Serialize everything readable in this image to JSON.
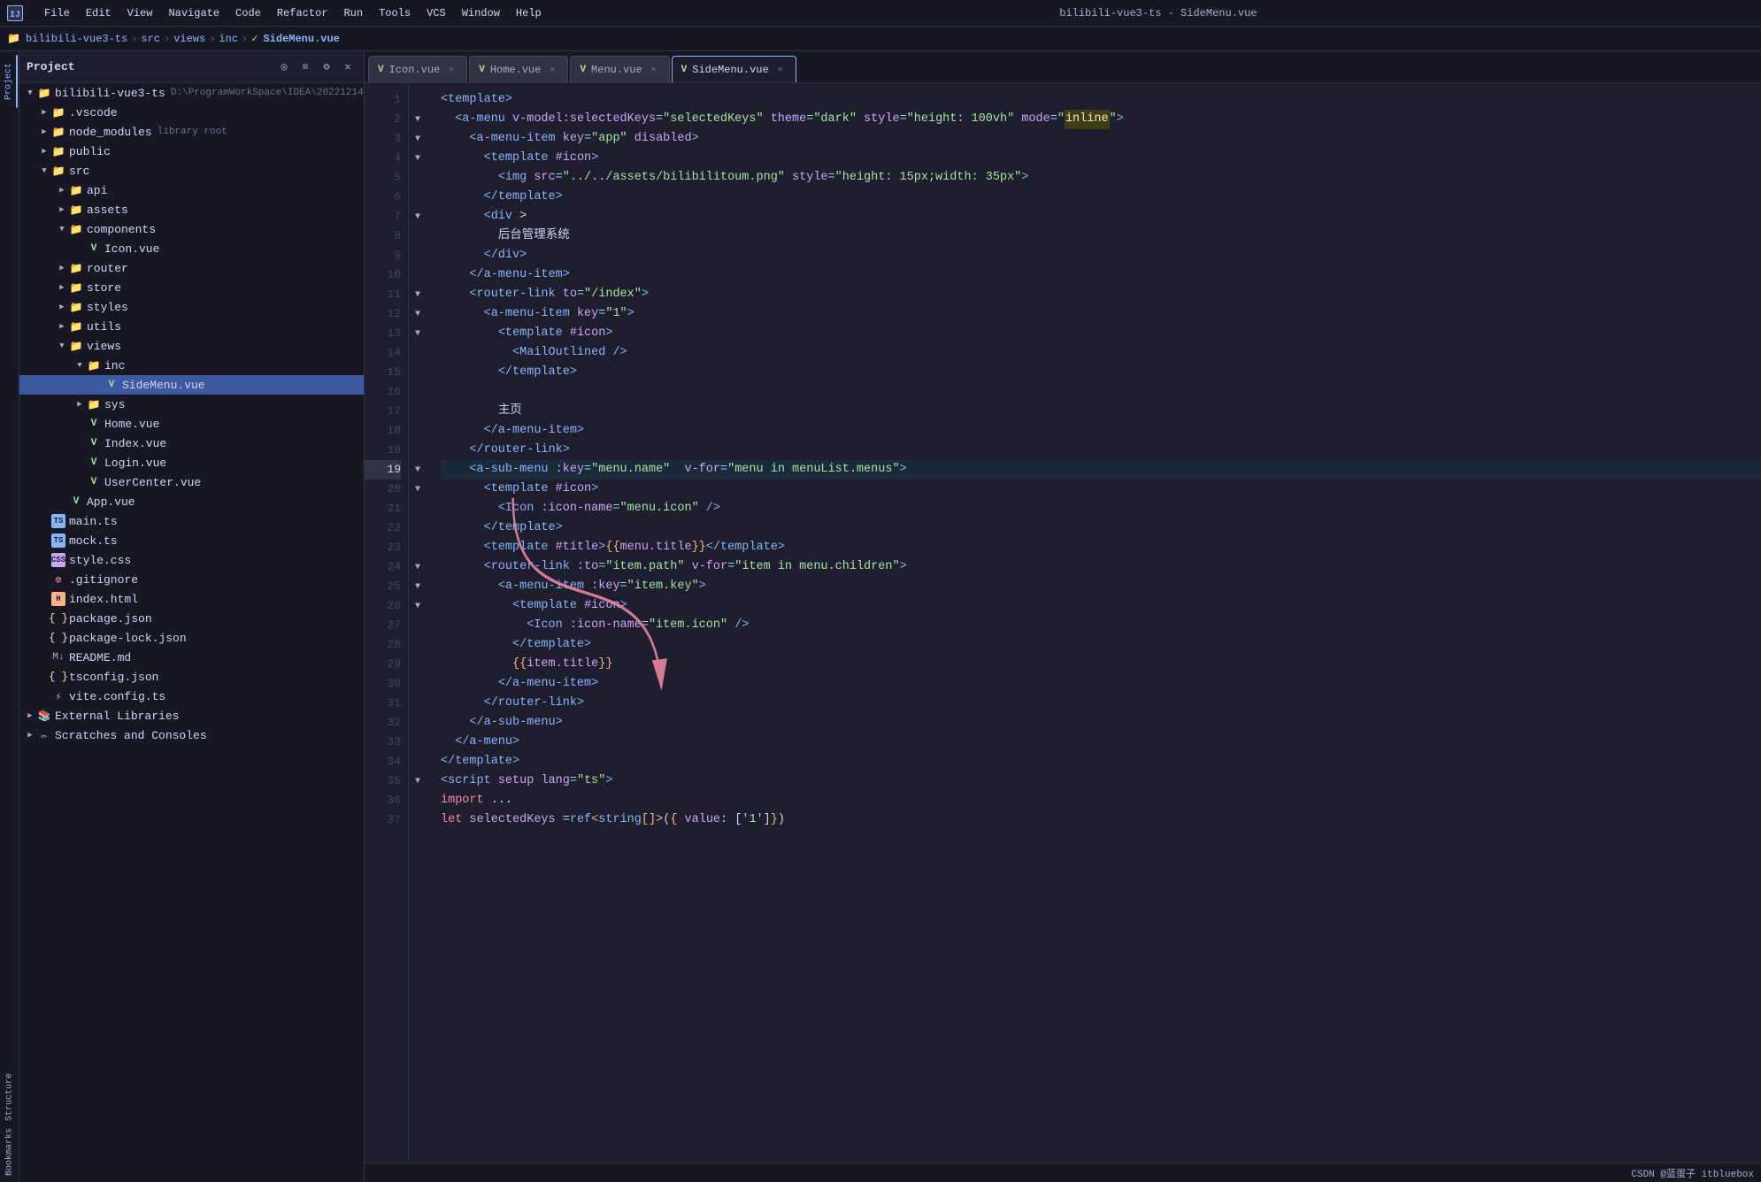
{
  "titleBar": {
    "logo": "⬡",
    "menus": [
      "File",
      "Edit",
      "View",
      "Navigate",
      "Code",
      "Refactor",
      "Run",
      "Tools",
      "VCS",
      "Window",
      "Help"
    ],
    "title": "bilibili-vue3-ts - SideMenu.vue"
  },
  "breadcrumb": {
    "items": [
      "bilibili-vue3-ts",
      "src",
      "views",
      "inc"
    ],
    "file": "SideMenu.vue"
  },
  "tabs": [
    {
      "label": "Icon.vue",
      "icon": "V",
      "active": false
    },
    {
      "label": "Home.vue",
      "icon": "V",
      "active": false
    },
    {
      "label": "Menu.vue",
      "icon": "V",
      "active": false
    },
    {
      "label": "SideMenu.vue",
      "icon": "V",
      "active": true
    }
  ],
  "sidebar": {
    "title": "Project",
    "tree": [
      {
        "indent": 0,
        "type": "root",
        "label": "bilibili-vue3-ts",
        "secondary": "D:\\ProgramWorkSpace\\IDEA\\20221214",
        "expanded": true,
        "icon": "folder"
      },
      {
        "indent": 1,
        "type": "folder",
        "label": ".vscode",
        "expanded": false,
        "icon": "folder"
      },
      {
        "indent": 1,
        "type": "folder",
        "label": "node_modules",
        "secondary": "library root",
        "expanded": false,
        "icon": "folder"
      },
      {
        "indent": 1,
        "type": "folder",
        "label": "public",
        "expanded": false,
        "icon": "folder"
      },
      {
        "indent": 1,
        "type": "folder",
        "label": "src",
        "expanded": true,
        "icon": "folder-src"
      },
      {
        "indent": 2,
        "type": "folder",
        "label": "api",
        "expanded": false,
        "icon": "folder"
      },
      {
        "indent": 2,
        "type": "folder",
        "label": "assets",
        "expanded": false,
        "icon": "folder"
      },
      {
        "indent": 2,
        "type": "folder",
        "label": "components",
        "expanded": true,
        "icon": "folder"
      },
      {
        "indent": 3,
        "type": "file-vue",
        "label": "Icon.vue",
        "icon": "vue"
      },
      {
        "indent": 2,
        "type": "folder",
        "label": "router",
        "expanded": false,
        "icon": "folder"
      },
      {
        "indent": 2,
        "type": "folder",
        "label": "store",
        "expanded": false,
        "icon": "folder"
      },
      {
        "indent": 2,
        "type": "folder",
        "label": "styles",
        "expanded": false,
        "icon": "folder"
      },
      {
        "indent": 2,
        "type": "folder",
        "label": "utils",
        "expanded": false,
        "icon": "folder"
      },
      {
        "indent": 2,
        "type": "folder",
        "label": "views",
        "expanded": true,
        "icon": "folder"
      },
      {
        "indent": 3,
        "type": "folder",
        "label": "inc",
        "expanded": true,
        "icon": "folder"
      },
      {
        "indent": 4,
        "type": "file-vue",
        "label": "SideMenu.vue",
        "icon": "vue",
        "selected": true
      },
      {
        "indent": 3,
        "type": "folder",
        "label": "sys",
        "expanded": false,
        "icon": "folder"
      },
      {
        "indent": 3,
        "type": "file-vue",
        "label": "Home.vue",
        "icon": "vue"
      },
      {
        "indent": 3,
        "type": "file-vue",
        "label": "Index.vue",
        "icon": "vue"
      },
      {
        "indent": 3,
        "type": "file-vue",
        "label": "Login.vue",
        "icon": "vue"
      },
      {
        "indent": 3,
        "type": "file-vue",
        "label": "UserCenter.vue",
        "icon": "vue"
      },
      {
        "indent": 2,
        "type": "file-vue",
        "label": "App.vue",
        "icon": "vue"
      },
      {
        "indent": 1,
        "type": "file-ts",
        "label": "main.ts",
        "icon": "ts"
      },
      {
        "indent": 1,
        "type": "file-ts",
        "label": "mock.ts",
        "icon": "ts"
      },
      {
        "indent": 1,
        "type": "file-css",
        "label": "style.css",
        "icon": "css"
      },
      {
        "indent": 1,
        "type": "file-git",
        "label": ".gitignore",
        "icon": "git"
      },
      {
        "indent": 1,
        "type": "file-html",
        "label": "index.html",
        "icon": "html"
      },
      {
        "indent": 1,
        "type": "file-json",
        "label": "package.json",
        "icon": "json"
      },
      {
        "indent": 1,
        "type": "file-json",
        "label": "package-lock.json",
        "icon": "json"
      },
      {
        "indent": 1,
        "type": "file-md",
        "label": "README.md",
        "icon": "md"
      },
      {
        "indent": 1,
        "type": "file-json",
        "label": "tsconfig.json",
        "icon": "json"
      },
      {
        "indent": 1,
        "type": "file-vite",
        "label": "vite.config.ts",
        "icon": "vite"
      },
      {
        "indent": 0,
        "type": "folder",
        "label": "External Libraries",
        "expanded": false,
        "icon": "external"
      },
      {
        "indent": 0,
        "type": "folder",
        "label": "Scratches and Consoles",
        "expanded": false,
        "icon": "folder"
      }
    ]
  },
  "codeLines": [
    {
      "num": 1,
      "content": "<template>"
    },
    {
      "num": 2,
      "content": "  <a-menu v-model:selectedKeys=\"selectedKeys\" theme=\"dark\" style=\"height: 100vh\" mode=\"inline\">"
    },
    {
      "num": 3,
      "content": "    <a-menu-item key=\"app\" disabled>"
    },
    {
      "num": 4,
      "content": "      <template #icon>"
    },
    {
      "num": 5,
      "content": "        <img src=\"../../assets/bilibilitoum.png\" style=\"height: 15px;width: 35px\">"
    },
    {
      "num": 6,
      "content": "      </template>"
    },
    {
      "num": 7,
      "content": "      <div >"
    },
    {
      "num": 8,
      "content": "        后台管理系统"
    },
    {
      "num": 9,
      "content": "      </div>"
    },
    {
      "num": 10,
      "content": "    </a-menu-item>"
    },
    {
      "num": 11,
      "content": "    <router-link to=\"/index\">"
    },
    {
      "num": 12,
      "content": "      <a-menu-item key=\"1\">"
    },
    {
      "num": 13,
      "content": "        <template #icon>"
    },
    {
      "num": 14,
      "content": "          <MailOutlined />"
    },
    {
      "num": 15,
      "content": "        </template>"
    },
    {
      "num": 16,
      "content": ""
    },
    {
      "num": 17,
      "content": "        主页"
    },
    {
      "num": 18,
      "content": "      </a-menu-item>"
    },
    {
      "num": 19,
      "content": "    </router-link>"
    },
    {
      "num": 19,
      "content": "    <a-sub-menu :key=\"menu.name\"  v-for=\"menu in menuList.menus\">"
    },
    {
      "num": 20,
      "content": "      <template #icon>"
    },
    {
      "num": 21,
      "content": "        <Icon :icon-name=\"menu.icon\" />"
    },
    {
      "num": 22,
      "content": "      </template>"
    },
    {
      "num": 23,
      "content": "      <template #title>{{menu.title}}</template>"
    },
    {
      "num": 24,
      "content": "      <router-link :to=\"item.path\" v-for=\"item in menu.children\">"
    },
    {
      "num": 25,
      "content": "        <a-menu-item :key=\"item.key\">"
    },
    {
      "num": 26,
      "content": "          <template #icon>"
    },
    {
      "num": 27,
      "content": "            <Icon :icon-name=\"item.icon\" />"
    },
    {
      "num": 28,
      "content": "          </template>"
    },
    {
      "num": 29,
      "content": "          {{item.title}}"
    },
    {
      "num": 30,
      "content": "        </a-menu-item>"
    },
    {
      "num": 31,
      "content": "      </router-link>"
    },
    {
      "num": 32,
      "content": "    </a-sub-menu>"
    },
    {
      "num": 33,
      "content": "  </a-menu>"
    },
    {
      "num": 34,
      "content": "</template>"
    },
    {
      "num": 35,
      "content": "<script setup lang=\"ts\">"
    },
    {
      "num": 36,
      "content": "import ..."
    },
    {
      "num": 37,
      "content": "let selectedKeys =ref<string[]>({ value: ['1']})"
    }
  ],
  "statusBar": {
    "text": "CSDN @蓝蛋子 itbluebox"
  }
}
